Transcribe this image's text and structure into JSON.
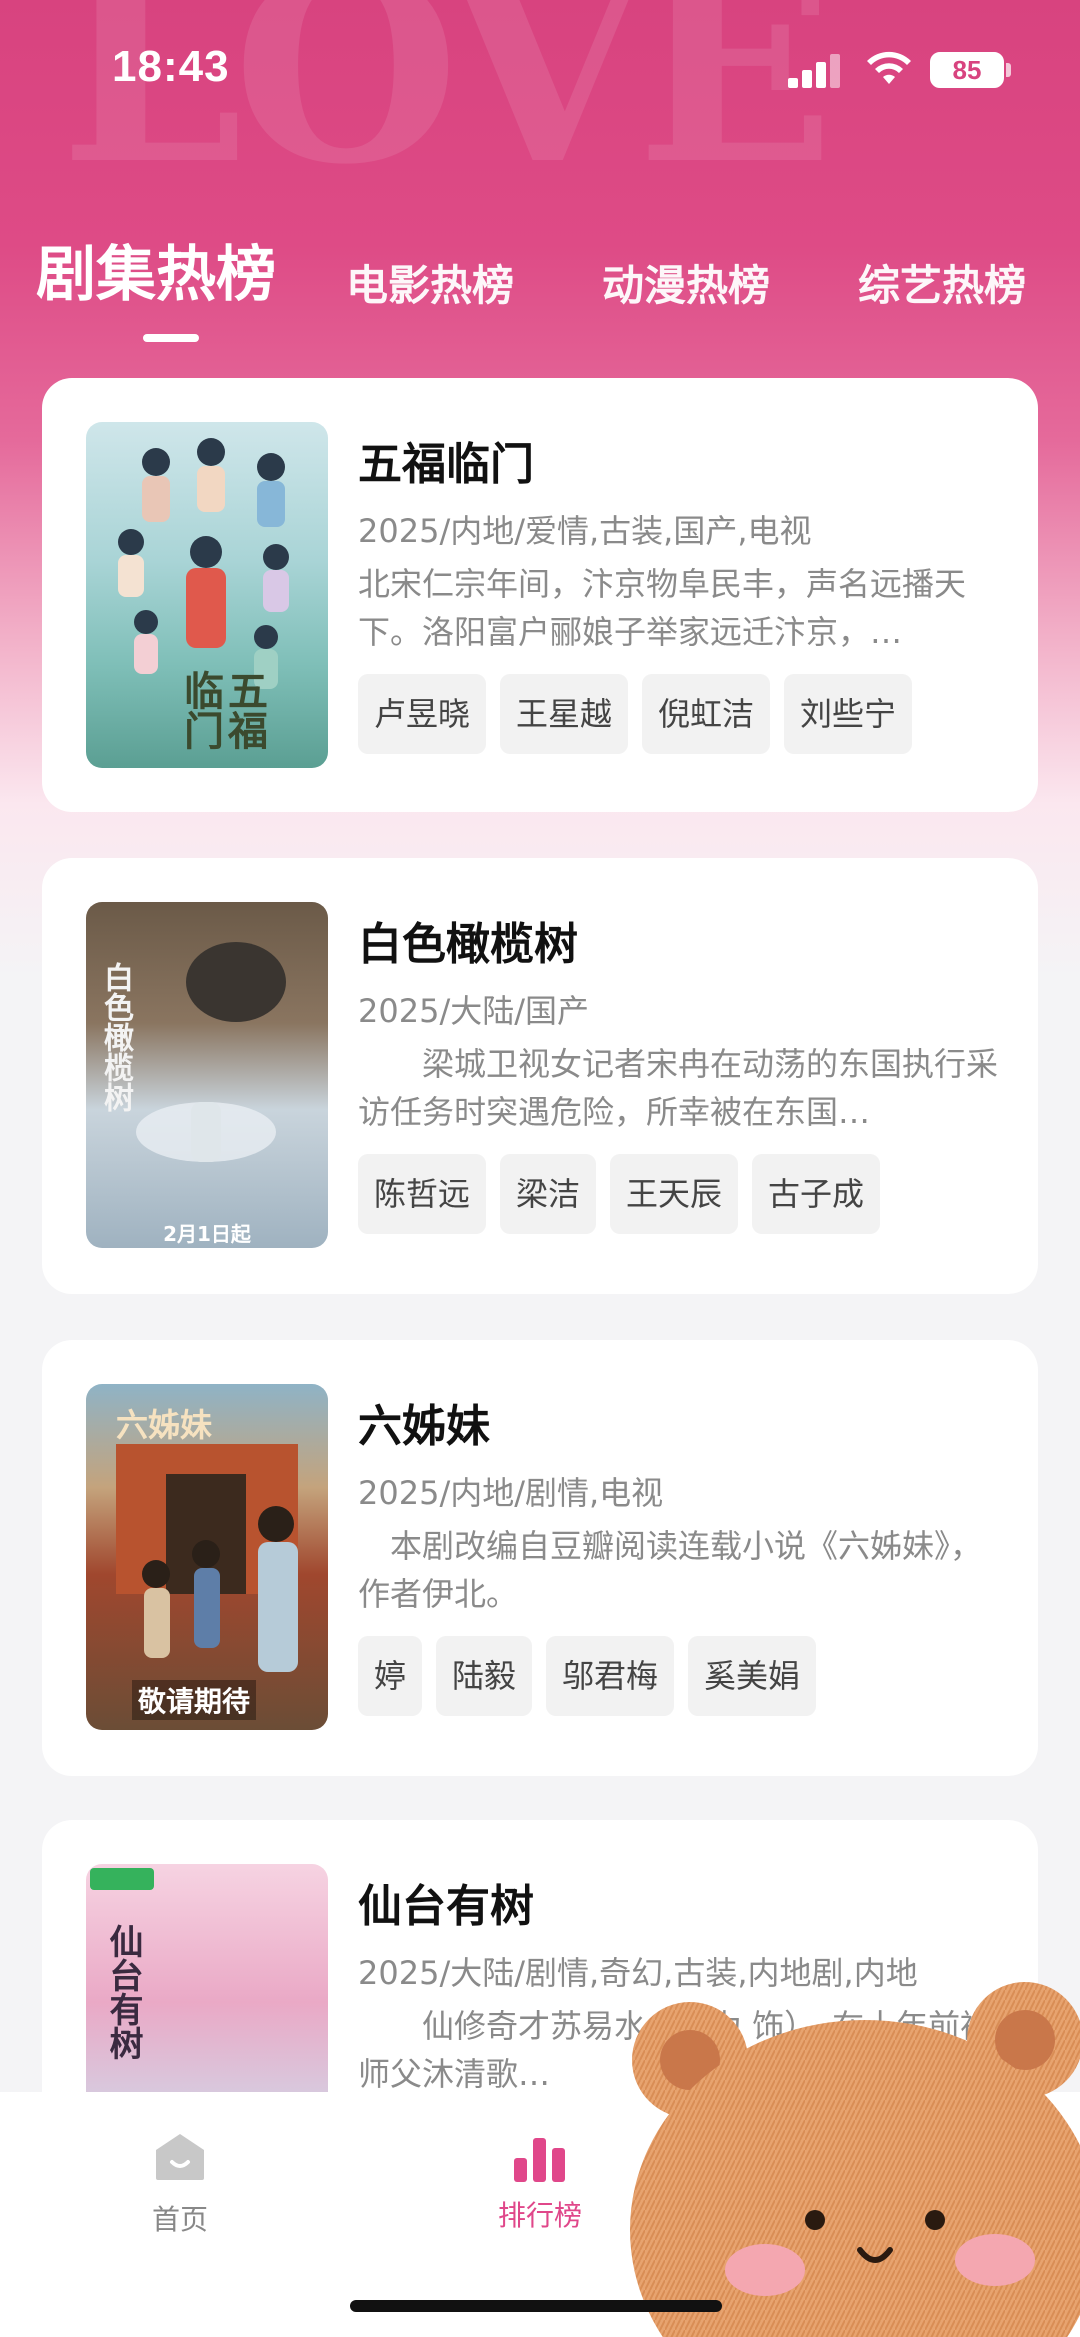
{
  "status_bar": {
    "time": "18:43",
    "battery": "85"
  },
  "tabs": [
    {
      "label": "剧集热榜",
      "active": true
    },
    {
      "label": "电影热榜",
      "active": false
    },
    {
      "label": "动漫热榜",
      "active": false
    },
    {
      "label": "综艺热榜",
      "active": false
    }
  ],
  "cards": [
    {
      "title": "五福临门",
      "meta": "2025/内地/爱情,古装,国产,电视",
      "desc": "北宋仁宗年间，汴京物阜民丰，声名远播天下。洛阳富户郦娘子举家远迁汴京，…",
      "tags": [
        "卢昱晓",
        "王星越",
        "倪虹洁",
        "刘些宁"
      ],
      "poster_text": "五福临门"
    },
    {
      "title": "白色橄榄树",
      "meta": "2025/大陆/国产",
      "desc": "　　梁城卫视女记者宋冉在动荡的东国执行采访任务时突遇危险，所幸被在东国…",
      "tags": [
        "陈哲远",
        "梁洁",
        "王天辰",
        "古子成"
      ],
      "poster_text": "白色橄榄树",
      "poster_date": "2月1日起"
    },
    {
      "title": "六姊妹",
      "meta": "2025/内地/剧情,电视",
      "desc": "　本剧改编自豆瓣阅读连载小说《六姊妹》， 作者伊北。",
      "tags": [
        "婷",
        "陆毅",
        "邬君梅",
        "奚美娟"
      ],
      "poster_text": "六姊妹",
      "poster_sub": "敬请期待"
    },
    {
      "title": "仙台有树",
      "meta": "2025/大陆/剧情,奇幻,古装,内地剧,内地",
      "desc": "　　仙修奇才苏易水（邓为 饰），在十年前被师父沐清歌…",
      "tags": [],
      "poster_text": "仙台有树"
    }
  ],
  "bottom_nav": {
    "home_label": "首页",
    "rank_label": "排行榜"
  },
  "colors": {
    "accent": "#e0478a",
    "hero": "#d8437f"
  }
}
